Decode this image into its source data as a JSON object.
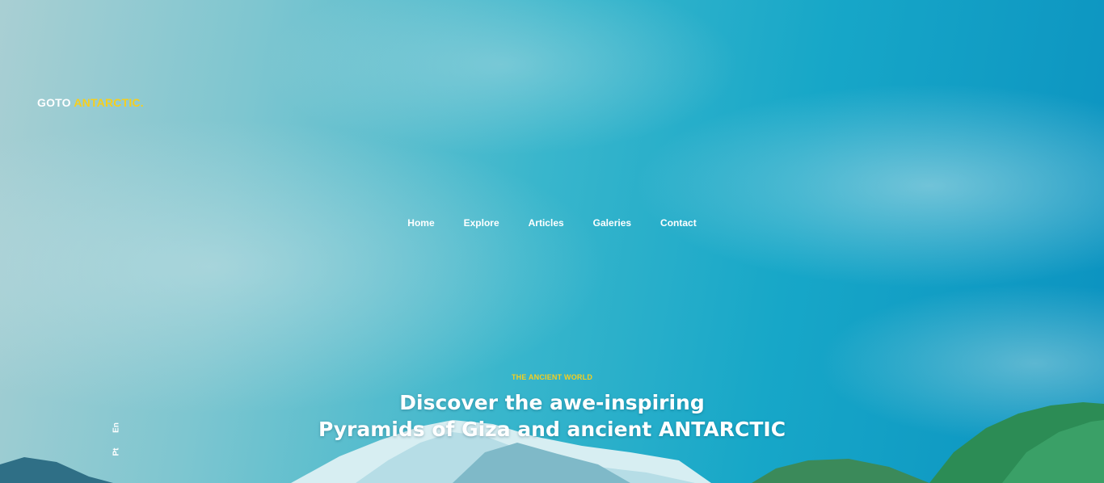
{
  "logo": {
    "part1": "GOTO ",
    "part2": "ANTARCTIC."
  },
  "nav": {
    "items": [
      {
        "label": "Home"
      },
      {
        "label": "Explore"
      },
      {
        "label": "Articles"
      },
      {
        "label": "Galeries"
      },
      {
        "label": "Contact"
      }
    ]
  },
  "hero": {
    "eyebrow": "THE ANCIENT WORLD",
    "title_line1": "Discover the awe-inspiring",
    "title_line2": "Pyramids of Giza and ancient ANTARCTIC"
  },
  "language": {
    "en": "En",
    "pt": "Pt"
  },
  "colors": {
    "accent": "#f7cf1d",
    "sky": "#17a7c8",
    "text": "#ffffff"
  }
}
